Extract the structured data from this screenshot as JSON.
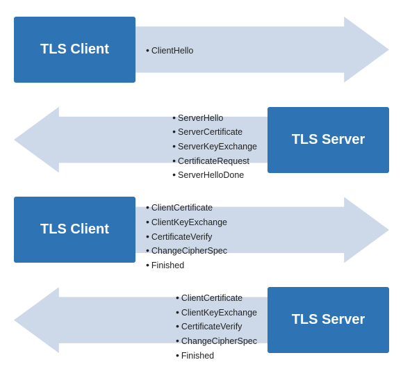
{
  "rows": [
    {
      "id": "row1",
      "direction": "right",
      "boxLabel": "TLS Client",
      "boxSide": "left",
      "items": [
        "ClientHello"
      ]
    },
    {
      "id": "row2",
      "direction": "left",
      "boxLabel": "TLS Server",
      "boxSide": "right",
      "items": [
        "ServerHello",
        "ServerCertificate",
        "ServerKeyExchange",
        "CertificateRequest",
        "ServerHelloDone"
      ]
    },
    {
      "id": "row3",
      "direction": "right",
      "boxLabel": "TLS Client",
      "boxSide": "left",
      "items": [
        "ClientCertificate",
        "ClientKeyExchange",
        "CertificateVerify",
        "ChangeCipherSpec",
        "Finished"
      ]
    },
    {
      "id": "row4",
      "direction": "left",
      "boxLabel": "TLS Server",
      "boxSide": "right",
      "items": [
        "ClientCertificate",
        "ClientKeyExchange",
        "CertificateVerify",
        "ChangeCipherSpec",
        "Finished"
      ]
    }
  ]
}
